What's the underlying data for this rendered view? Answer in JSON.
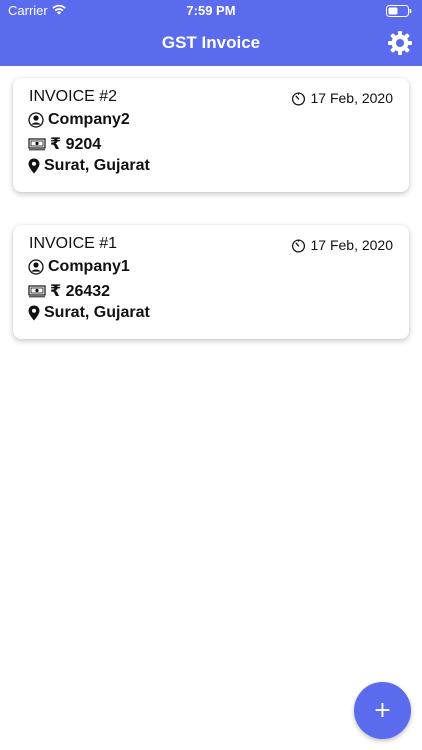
{
  "status_bar": {
    "carrier": "Carrier",
    "time": "7:59 PM"
  },
  "header": {
    "title": "GST Invoice",
    "settings_icon": "gear-icon"
  },
  "invoices": [
    {
      "title": "INVOICE #2",
      "date": "17 Feb, 2020",
      "company": "Company2",
      "amount": "₹ 9204",
      "location": "Surat, Gujarat"
    },
    {
      "title": "INVOICE #1",
      "date": "17 Feb, 2020",
      "company": "Company1",
      "amount": "₹ 26432",
      "location": "Surat, Gujarat"
    }
  ],
  "fab": {
    "label": "+"
  },
  "colors": {
    "accent": "#5a6bee",
    "card_bg": "#ffffff",
    "text": "#111111"
  }
}
